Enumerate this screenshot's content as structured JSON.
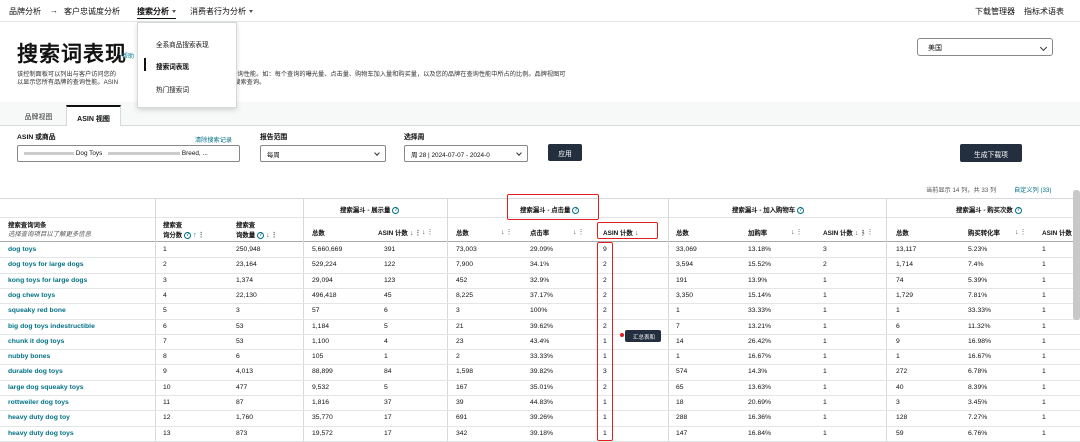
{
  "nav": {
    "brand_analytics": "品牌分析",
    "arrow": "→",
    "customer_loyalty": "客户忠诚度分析",
    "search_analytics": "搜索分析",
    "consumer_behavior": "消费者行为分析",
    "download_manager": "下载管理器",
    "metric_glossary": "指标术语表"
  },
  "dropdown": {
    "items": [
      "全系商品搜索表现",
      "搜索词表现",
      "热门搜索词"
    ],
    "selected_index": 1
  },
  "page": {
    "title": "搜索词表现",
    "help_link": "帮助",
    "desc_line1": "该控制面板可以列出与客户访问您的",
    "desc_line1_tail": "整体查询性能。如：每个查询的曝光量、点击量、购物车加入量和购买量，以及您的品牌在查询性能中所占的比例。品牌视图可",
    "desc_line2": "以显示您所有品牌的查询性能。ASIN",
    "desc_line2_tail": "门搜索查询。",
    "country": "美国"
  },
  "tabs": [
    "品牌视图",
    "ASIN 视图"
  ],
  "filters": {
    "asin_label": "ASIN 或商品",
    "clear_history": "清除搜索记录",
    "asin_value_mid": "Dog Toys",
    "asin_value_tail": "Breed, ...",
    "range_label": "报告范围",
    "range_value": "每周",
    "week_label": "选择周",
    "week_value": "周 28 | 2024-07-07 - 2024-0",
    "apply": "应用",
    "generate_download": "生成下载项"
  },
  "table_meta": {
    "showing": "当前显示 14 列，共 33 列",
    "custom_columns": "自定义列 (33)"
  },
  "headers": {
    "group_impressions": "搜索漏斗 - 展示量",
    "group_clicks": "搜索漏斗 - 点击量",
    "group_cart": "搜索漏斗 - 加入购物车",
    "group_purchases": "搜索漏斗 - 购买次数",
    "query_term": "搜索查询词条",
    "query_hint": "选择查询项目以了解更多信息",
    "query_score_l1": "搜索查",
    "query_score_l2": "询分数",
    "query_volume_l1": "搜索查",
    "query_volume_l2": "询数量",
    "total": "总数",
    "asin_count": "ASIN 计数",
    "click_rate": "点击率",
    "cart_rate": "加购率",
    "purchase_rate": "购买转化率"
  },
  "rows": [
    {
      "term": "dog toys",
      "score": "1",
      "volume": "250,948",
      "imp_total": "5,660,669",
      "imp_asin": "391",
      "clk_total": "73,003",
      "clk_rate": "29.09%",
      "clk_asin": "9",
      "cart_total": "33,069",
      "cart_rate": "13.18%",
      "cart_asin": "3",
      "pur_total": "13,117",
      "pur_rate": "5.23%",
      "pur_asin": "1"
    },
    {
      "term": "dog toys for large dogs",
      "score": "2",
      "volume": "23,164",
      "imp_total": "529,224",
      "imp_asin": "122",
      "clk_total": "7,900",
      "clk_rate": "34.1%",
      "clk_asin": "2",
      "cart_total": "3,594",
      "cart_rate": "15.52%",
      "cart_asin": "2",
      "pur_total": "1,714",
      "pur_rate": "7.4%",
      "pur_asin": "1"
    },
    {
      "term": "kong toys for large dogs",
      "score": "3",
      "volume": "1,374",
      "imp_total": "29,094",
      "imp_asin": "123",
      "clk_total": "452",
      "clk_rate": "32.9%",
      "clk_asin": "2",
      "cart_total": "191",
      "cart_rate": "13.9%",
      "cart_asin": "1",
      "pur_total": "74",
      "pur_rate": "5.39%",
      "pur_asin": "1"
    },
    {
      "term": "dog chew toys",
      "score": "4",
      "volume": "22,130",
      "imp_total": "496,418",
      "imp_asin": "45",
      "clk_total": "8,225",
      "clk_rate": "37.17%",
      "clk_asin": "2",
      "cart_total": "3,350",
      "cart_rate": "15.14%",
      "cart_asin": "1",
      "pur_total": "1,729",
      "pur_rate": "7.81%",
      "pur_asin": "1"
    },
    {
      "term": "squeaky red bone",
      "score": "5",
      "volume": "3",
      "imp_total": "57",
      "imp_asin": "6",
      "clk_total": "3",
      "clk_rate": "100%",
      "clk_asin": "2",
      "cart_total": "1",
      "cart_rate": "33.33%",
      "cart_asin": "1",
      "pur_total": "1",
      "pur_rate": "33.33%",
      "pur_asin": "1"
    },
    {
      "term": "big dog toys indestructible",
      "score": "6",
      "volume": "53",
      "imp_total": "1,184",
      "imp_asin": "5",
      "clk_total": "21",
      "clk_rate": "39.62%",
      "clk_asin": "2",
      "cart_total": "7",
      "cart_rate": "13.21%",
      "cart_asin": "1",
      "pur_total": "6",
      "pur_rate": "11.32%",
      "pur_asin": "1"
    },
    {
      "term": "chunk it dog toys",
      "score": "7",
      "volume": "53",
      "imp_total": "1,100",
      "imp_asin": "4",
      "clk_total": "23",
      "clk_rate": "43.4%",
      "clk_asin": "1",
      "cart_total": "14",
      "cart_rate": "26.42%",
      "cart_asin": "1",
      "pur_total": "9",
      "pur_rate": "16.98%",
      "pur_asin": "1"
    },
    {
      "term": "nubby bones",
      "score": "8",
      "volume": "6",
      "imp_total": "105",
      "imp_asin": "1",
      "clk_total": "2",
      "clk_rate": "33.33%",
      "clk_asin": "1",
      "cart_total": "1",
      "cart_rate": "16.67%",
      "cart_asin": "1",
      "pur_total": "1",
      "pur_rate": "16.67%",
      "pur_asin": "1"
    },
    {
      "term": "durable dog toys",
      "score": "9",
      "volume": "4,013",
      "imp_total": "88,899",
      "imp_asin": "84",
      "clk_total": "1,598",
      "clk_rate": "39.82%",
      "clk_asin": "3",
      "cart_total": "574",
      "cart_rate": "14.3%",
      "cart_asin": "1",
      "pur_total": "272",
      "pur_rate": "6.78%",
      "pur_asin": "1"
    },
    {
      "term": "large dog squeaky toys",
      "score": "10",
      "volume": "477",
      "imp_total": "9,532",
      "imp_asin": "5",
      "clk_total": "167",
      "clk_rate": "35.01%",
      "clk_asin": "2",
      "cart_total": "65",
      "cart_rate": "13.63%",
      "cart_asin": "1",
      "pur_total": "40",
      "pur_rate": "8.39%",
      "pur_asin": "1"
    },
    {
      "term": "rottweiler dog toys",
      "score": "11",
      "volume": "87",
      "imp_total": "1,816",
      "imp_asin": "37",
      "clk_total": "39",
      "clk_rate": "44.83%",
      "clk_asin": "1",
      "cart_total": "18",
      "cart_rate": "20.69%",
      "cart_asin": "1",
      "pur_total": "3",
      "pur_rate": "3.45%",
      "pur_asin": "1"
    },
    {
      "term": "heavy duty dog toy",
      "score": "12",
      "volume": "1,760",
      "imp_total": "35,770",
      "imp_asin": "17",
      "clk_total": "691",
      "clk_rate": "39.26%",
      "clk_asin": "1",
      "cart_total": "288",
      "cart_rate": "16.36%",
      "cart_asin": "1",
      "pur_total": "128",
      "pur_rate": "7.27%",
      "pur_asin": "1"
    },
    {
      "term": "heavy duty dog toys",
      "score": "13",
      "volume": "873",
      "imp_total": "19,572",
      "imp_asin": "17",
      "clk_total": "342",
      "clk_rate": "39.18%",
      "clk_asin": "1",
      "cart_total": "147",
      "cart_rate": "16.84%",
      "cart_asin": "1",
      "pur_total": "59",
      "pur_rate": "6.76%",
      "pur_asin": "1"
    }
  ],
  "tooltip": "汇总表和",
  "colors": {
    "link": "#007185",
    "button": "#232f3e",
    "highlight": "#e02020"
  }
}
